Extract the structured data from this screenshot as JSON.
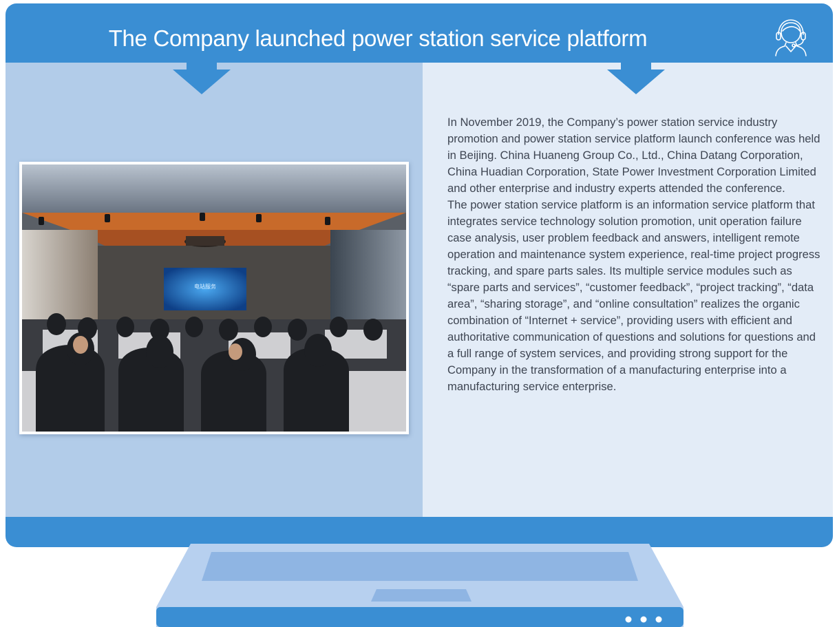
{
  "header": {
    "title": "The Company launched power station service platform",
    "icon": "headset-support-icon"
  },
  "photo": {
    "subject": "conference-hall-photo",
    "stage_screen_label": "电站服务"
  },
  "article": {
    "paragraphs": [
      "In November 2019, the Company’s power station service industry promotion and power station service platform launch conference was held in Beijing. China Huaneng Group Co., Ltd., China Datang Corporation, China Huadian Corporation, State Power Investment Corporation Limited and other enterprise and industry experts attended the conference.",
      "The power station service platform is an information service platform that integrates service technology solution promotion, unit operation failure case analysis, user problem feedback and answers, intelligent remote operation and maintenance system experience, real-time project progress tracking, and spare parts sales. Its multiple service modules such as “spare parts and services”, “customer feedback”, “project tracking”, “data area”, “sharing storage”, and “online consultation” realizes the organic combination of “Internet + service”, providing users with efficient and authoritative communication of questions and solutions for questions and a full range of system services, and providing strong support for the Company in the transformation of a manufacturing enterprise into a manufacturing service enterprise."
    ]
  },
  "colors": {
    "frame_blue": "#3a8ed3",
    "left_panel": "#b2cce9",
    "right_panel": "#e3ecf7",
    "stand_light": "#b7d0ef",
    "stand_inner": "#8fb5e3",
    "text": "#3e4552"
  },
  "stand": {
    "indicator_dots": 3
  }
}
